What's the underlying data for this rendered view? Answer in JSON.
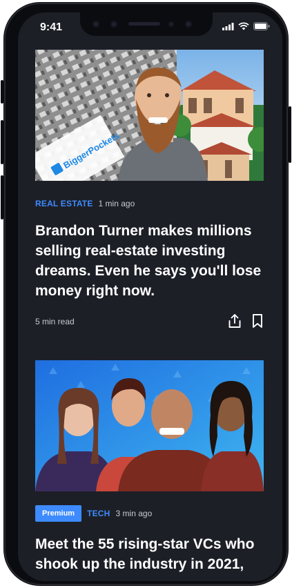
{
  "status_bar": {
    "time": "9:41"
  },
  "articles": [
    {
      "image_alt": "BiggerPockets",
      "brand_text": "BiggerPockets",
      "category": "REAL ESTATE",
      "time_ago": "1 min ago",
      "headline": "Brandon Turner makes millions selling real-estate investing dreams. Even he says you'll lose money right now.",
      "read_time": "5 min read"
    },
    {
      "badge": "Premium",
      "category": "TECH",
      "time_ago": "3 min ago",
      "headline": "Meet the 55 rising-star VCs who shook up the industry in 2021,"
    }
  ],
  "colors": {
    "accent": "#3d8bff",
    "background": "#1d1f27"
  },
  "icons": [
    "share-icon",
    "bookmark-icon",
    "signal-icon",
    "wifi-icon",
    "battery-icon"
  ]
}
